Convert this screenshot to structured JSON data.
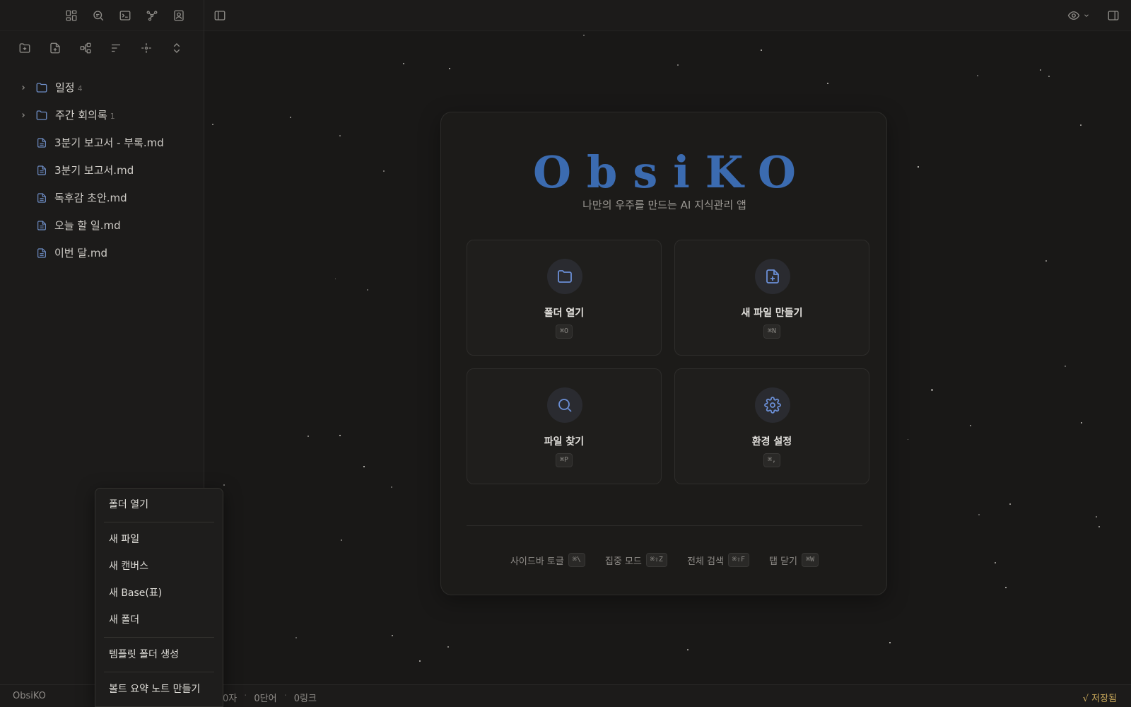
{
  "app": {
    "name": "ObsiKO"
  },
  "topbar": {
    "left_icons": [
      "layout-grid-icon",
      "search-text-icon",
      "terminal-icon",
      "graph-icon",
      "contact-icon"
    ],
    "toggle_sidebar_icon": "sidebar-left-icon",
    "right_icons": [
      "eye-icon",
      "chevron-down-icon",
      "sidebar-right-icon"
    ]
  },
  "sidebar": {
    "toolbar_icons": [
      "new-folder-icon",
      "new-file-icon",
      "canvas-icon",
      "sort-icon",
      "locate-icon",
      "expand-collapse-icon"
    ],
    "tree": [
      {
        "type": "folder",
        "name": "일정",
        "count": "4"
      },
      {
        "type": "folder",
        "name": "주간 회의록",
        "count": "1"
      },
      {
        "type": "file",
        "name": "3분기 보고서 - 부록.md"
      },
      {
        "type": "file",
        "name": "3분기 보고서.md"
      },
      {
        "type": "file",
        "name": "독후감 초안.md"
      },
      {
        "type": "file",
        "name": "오늘 할 일.md"
      },
      {
        "type": "file",
        "name": "이번 달.md"
      }
    ]
  },
  "welcome": {
    "logo": "ObsiKO",
    "tagline": "나만의 우주를 만드는 AI 지식관리 앱",
    "cards": [
      {
        "label": "폴더 열기",
        "shortcut": "⌘O",
        "icon": "folder-icon"
      },
      {
        "label": "새 파일 만들기",
        "shortcut": "⌘N",
        "icon": "file-plus-icon"
      },
      {
        "label": "파일 찾기",
        "shortcut": "⌘P",
        "icon": "search-icon"
      },
      {
        "label": "환경 설정",
        "shortcut": "⌘,",
        "icon": "gear-icon"
      }
    ],
    "shortcuts": [
      {
        "label": "사이드바 토글",
        "key": "⌘\\"
      },
      {
        "label": "집중 모드",
        "key": "⌘⇧Z"
      },
      {
        "label": "전체 검색",
        "key": "⌘⇧F"
      },
      {
        "label": "탭 닫기",
        "key": "⌘W"
      }
    ]
  },
  "context_menu": {
    "items": [
      "폴더 열기",
      "새 파일",
      "새 캔버스",
      "새 Base(표)",
      "새 폴더",
      "템플릿 폴더 생성",
      "볼트 요약 노트 만들기"
    ]
  },
  "statusbar": {
    "chars": "0자",
    "words": "0단어",
    "links": "0링크",
    "saved": "√ 저장됨"
  },
  "colors": {
    "accent": "#3b6bb0",
    "icon_blue": "#6b8fd6",
    "saved": "#c8a85a",
    "background": "#191817"
  }
}
